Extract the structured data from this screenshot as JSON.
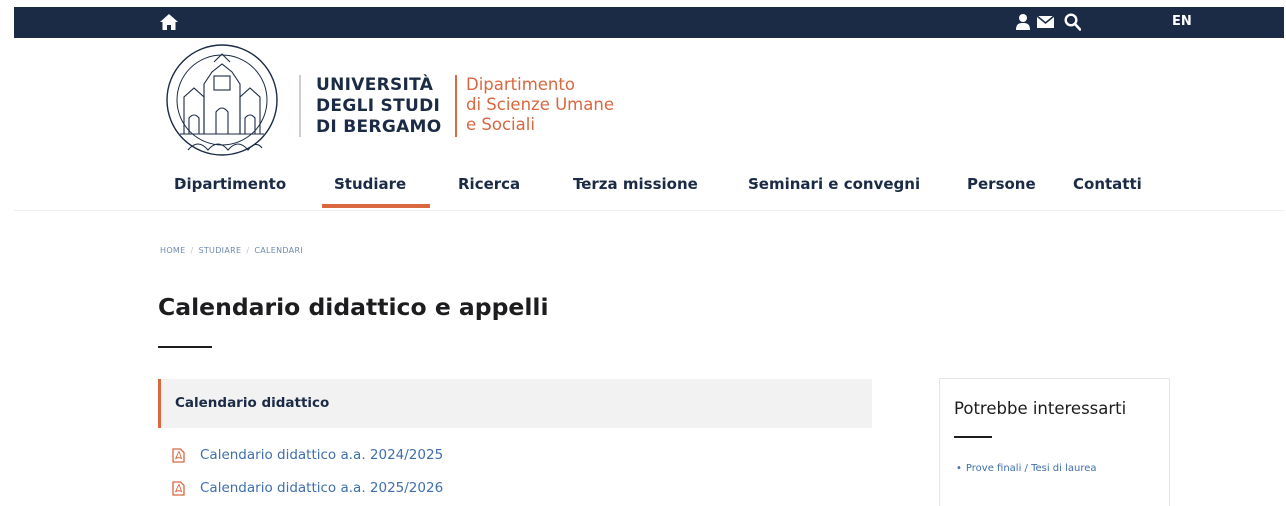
{
  "topbar": {
    "home_icon": "home-icon",
    "user_icon": "user-icon",
    "mail_icon": "mail-icon",
    "search_icon": "search-icon",
    "lang": "EN"
  },
  "brand": {
    "university_lines": [
      "UNIVERSITÀ",
      "DEGLI STUDI",
      "DI BERGAMO"
    ],
    "department_lines": [
      "Dipartimento",
      "di Scienze Umane",
      "e Sociali"
    ],
    "accent_color": "#d9673f",
    "navy_color": "#1b2a45"
  },
  "nav": {
    "items": [
      {
        "label": "Dipartimento",
        "caret": "-"
      },
      {
        "label": "Studiare",
        "caret": "-",
        "active": true
      },
      {
        "label": "Ricerca",
        "caret": "-"
      },
      {
        "label": "Terza missione",
        "caret": "-"
      },
      {
        "label": "Seminari e convegni",
        "caret": "-"
      },
      {
        "label": "Persone",
        "caret": ""
      },
      {
        "label": "Contatti",
        "caret": ""
      }
    ]
  },
  "breadcrumb": [
    "HOME",
    "STUDIARE",
    "CALENDARI"
  ],
  "page": {
    "title": "Calendario didattico e appelli"
  },
  "accordion": {
    "label": "Calendario didattico"
  },
  "documents": [
    {
      "label": "Calendario didattico a.a. 2024/2025",
      "icon": "pdf-icon"
    },
    {
      "label": "Calendario didattico a.a. 2025/2026",
      "icon": "pdf-icon"
    }
  ],
  "sidebar": {
    "title": "Potrebbe interessarti",
    "links": [
      {
        "label": "Prove finali / Tesi di laurea"
      }
    ]
  }
}
